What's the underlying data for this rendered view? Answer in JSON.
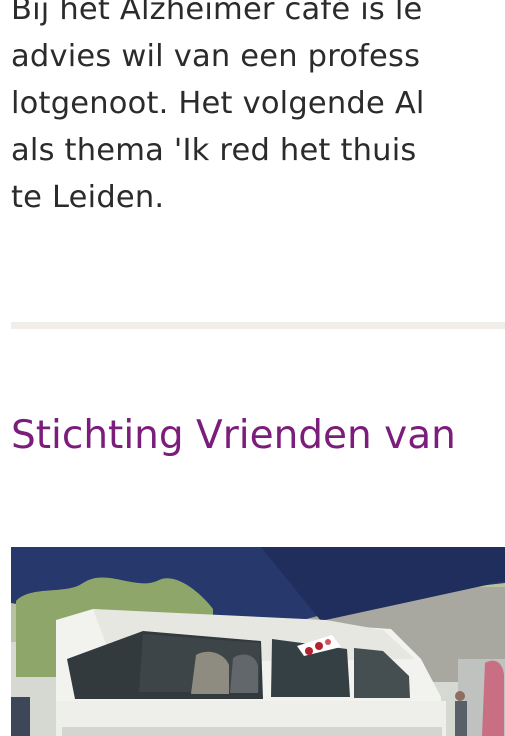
{
  "article": {
    "lines": [
      "Bij het Alzheimer café is le",
      "advies wil van een profess",
      "lotgenoot. Het volgende Al",
      "als thema 'Ik red het thuis",
      "te Leiden."
    ]
  },
  "section": {
    "title": "Stichting Vrienden van"
  },
  "colors": {
    "title": "#7a1d7b",
    "divider": "#f1eee9",
    "text": "#2b2b2b"
  }
}
